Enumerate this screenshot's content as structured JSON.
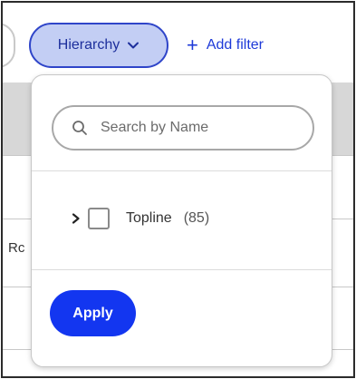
{
  "filter_bar": {
    "hierarchy_chip_label": "Hierarchy",
    "add_filter_label": "Add filter"
  },
  "background": {
    "row_text": "Rc"
  },
  "dropdown": {
    "search_placeholder": "Search by Name",
    "search_value": "",
    "items": [
      {
        "label": "Topline",
        "count": "(85)",
        "checked": false,
        "expanded": false
      }
    ],
    "apply_label": "Apply"
  },
  "colors": {
    "accent": "#1336f0",
    "chip_bg": "#c3cef4",
    "chip_border": "#2f45c9",
    "link": "#1e3ad8"
  },
  "icons": {
    "chip_chevron": "chevron-down-icon",
    "add": "plus-icon",
    "search": "search-icon",
    "expander": "chevron-right-icon"
  }
}
